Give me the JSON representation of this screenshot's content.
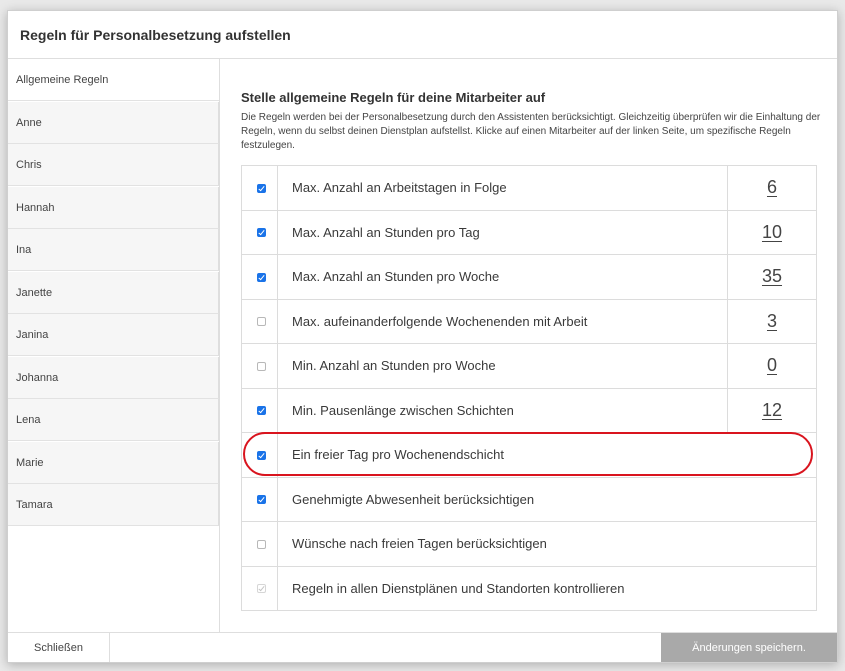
{
  "modal": {
    "title": "Regeln für Personalbesetzung aufstellen"
  },
  "sidebar": {
    "items": [
      {
        "label": "Allgemeine Regeln",
        "active": true
      },
      {
        "label": "Anne"
      },
      {
        "label": "Chris"
      },
      {
        "label": "Hannah"
      },
      {
        "label": "Ina"
      },
      {
        "label": "Janette"
      },
      {
        "label": "Janina"
      },
      {
        "label": "Johanna"
      },
      {
        "label": "Lena"
      },
      {
        "label": "Marie"
      },
      {
        "label": "Tamara"
      }
    ]
  },
  "main": {
    "heading": "Stelle allgemeine Regeln für deine Mitarbeiter auf",
    "description": "Die Regeln werden bei der Personalbesetzung durch den Assistenten berücksichtigt. Gleichzeitig überprüfen wir die Einhaltung der Regeln, wenn du selbst deinen Dienstplan aufstellst. Klicke auf einen Mitarbeiter auf der linken Seite, um spezifische Regeln festzulegen.",
    "rules": [
      {
        "label": "Max. Anzahl an Arbeitstagen in Folge",
        "checked": true,
        "value": "6"
      },
      {
        "label": "Max. Anzahl an Stunden pro Tag",
        "checked": true,
        "value": "10"
      },
      {
        "label": "Max. Anzahl an Stunden pro Woche",
        "checked": true,
        "value": "35"
      },
      {
        "label": "Max. aufeinanderfolgende Wochenenden mit Arbeit",
        "checked": false,
        "value": "3"
      },
      {
        "label": "Min. Anzahl an Stunden pro Woche",
        "checked": false,
        "value": "0"
      },
      {
        "label": "Min. Pausenlänge zwischen Schichten",
        "checked": true,
        "value": "12"
      },
      {
        "label": "Ein freier Tag pro Wochenendschicht",
        "checked": true
      },
      {
        "label": "Genehmigte Abwesenheit berücksichtigen",
        "checked": true
      },
      {
        "label": "Wünsche nach freien Tagen berücksichtigen",
        "checked": false
      },
      {
        "label": "Regeln in allen Dienstplänen und Standorten kontrollieren",
        "checked": true,
        "disabled": true
      }
    ]
  },
  "footer": {
    "close_label": "Schließen",
    "save_label": "Änderungen speichern."
  },
  "colors": {
    "checkbox_on": "#1a73e8",
    "highlight": "#d9141e",
    "save_button": "#a9a9a9"
  }
}
